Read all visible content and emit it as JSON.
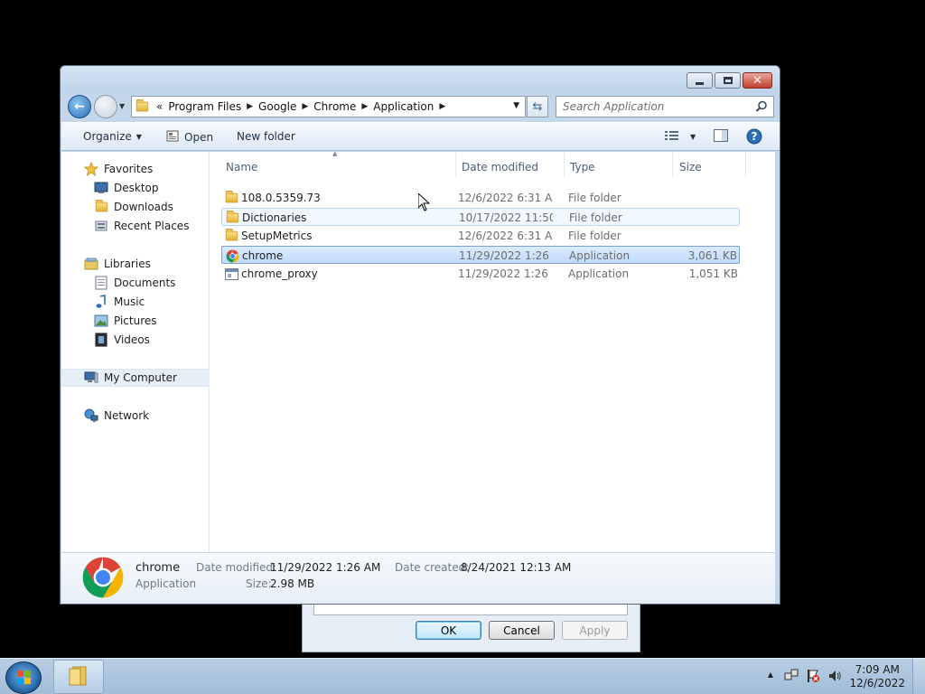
{
  "background_dialog": {
    "ok_label": "OK",
    "cancel_label": "Cancel",
    "apply_label": "Apply"
  },
  "window": {
    "address": {
      "overflow": "«",
      "crumbs": [
        "Program Files",
        "Google",
        "Chrome",
        "Application"
      ]
    },
    "search_placeholder": "Search Application",
    "toolbar": {
      "organize": "Organize",
      "open": "Open",
      "new_folder": "New folder"
    },
    "nav": {
      "favorites": "Favorites",
      "desktop": "Desktop",
      "downloads": "Downloads",
      "recent_places": "Recent Places",
      "libraries": "Libraries",
      "documents": "Documents",
      "music": "Music",
      "pictures": "Pictures",
      "videos": "Videos",
      "my_computer": "My Computer",
      "network": "Network"
    },
    "columns": {
      "name": "Name",
      "date_modified": "Date modified",
      "type": "Type",
      "size": "Size"
    },
    "files": [
      {
        "name": "108.0.5359.73",
        "date": "12/6/2022 6:31 AM",
        "type": "File folder",
        "size": "",
        "icon": "folder-icon"
      },
      {
        "name": "Dictionaries",
        "date": "10/17/2022 11:50 ...",
        "type": "File folder",
        "size": "",
        "icon": "folder-icon"
      },
      {
        "name": "SetupMetrics",
        "date": "12/6/2022 6:31 AM",
        "type": "File folder",
        "size": "",
        "icon": "folder-icon"
      },
      {
        "name": "chrome",
        "date": "11/29/2022 1:26 AM",
        "type": "Application",
        "size": "3,061 KB",
        "icon": "chrome-icon"
      },
      {
        "name": "chrome_proxy",
        "date": "11/29/2022 1:26 AM",
        "type": "Application",
        "size": "1,051 KB",
        "icon": "application-icon"
      }
    ],
    "details": {
      "name": "chrome",
      "type": "Application",
      "date_modified_label": "Date modified:",
      "date_modified": "11/29/2022 1:26 AM",
      "date_created_label": "Date created:",
      "date_created": "8/24/2021 12:13 AM",
      "size_label": "Size:",
      "size": "2.98 MB"
    }
  },
  "taskbar": {
    "time": "7:09 AM",
    "date": "12/6/2022"
  },
  "colors": {
    "selection": "#c1dbfc",
    "hover": "#f2f8ff",
    "chrome_red": "#db4437",
    "chrome_green": "#0f9d58",
    "chrome_yellow": "#f4b400",
    "chrome_blue": "#4285f4"
  }
}
